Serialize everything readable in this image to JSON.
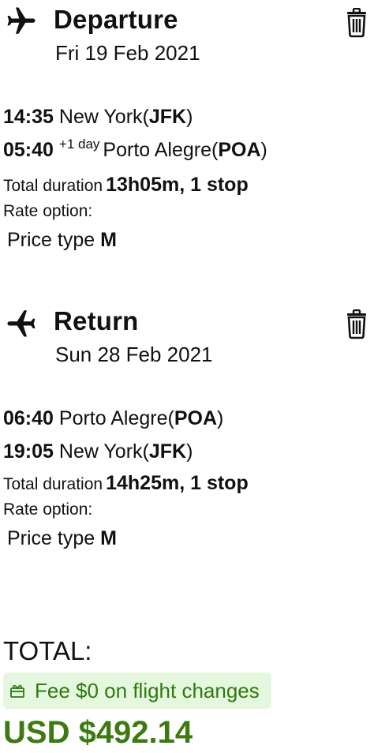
{
  "departure": {
    "title": "Departure",
    "date": "Fri 19 Feb 2021",
    "dep_time": "14:35",
    "dep_city": "New York(",
    "dep_code": "JFK",
    "dep_close": ")",
    "arr_time": "05:40",
    "arr_offset": "+1 day",
    "arr_city": "Porto Alegre(",
    "arr_code": "POA",
    "arr_close": ")",
    "duration_label": "Total duration",
    "duration_value": "13h05m, 1 stop",
    "rate_label": "Rate option:",
    "price_type_label": "Price type",
    "price_type_value": "M"
  },
  "return": {
    "title": "Return",
    "date": "Sun 28 Feb 2021",
    "dep_time": "06:40",
    "dep_city": "Porto Alegre(",
    "dep_code": "POA",
    "dep_close": ")",
    "arr_time": "19:05",
    "arr_city": "New York(",
    "arr_code": "JFK",
    "arr_close": ")",
    "duration_label": "Total duration",
    "duration_value": "14h25m, 1 stop",
    "rate_label": "Rate option:",
    "price_type_label": "Price type",
    "price_type_value": "M"
  },
  "summary": {
    "total_label": "TOTAL:",
    "fee_text": "Fee $0 on flight changes",
    "total_price": "USD $492.14"
  },
  "icons": {
    "departure": "airplane-departure-icon",
    "return": "airplane-return-icon",
    "delete": "trash-icon",
    "fee": "gift-icon"
  },
  "colors": {
    "fee_bg": "#e6f7df",
    "fee_text": "#2e7a10",
    "price": "#3d7a12"
  }
}
